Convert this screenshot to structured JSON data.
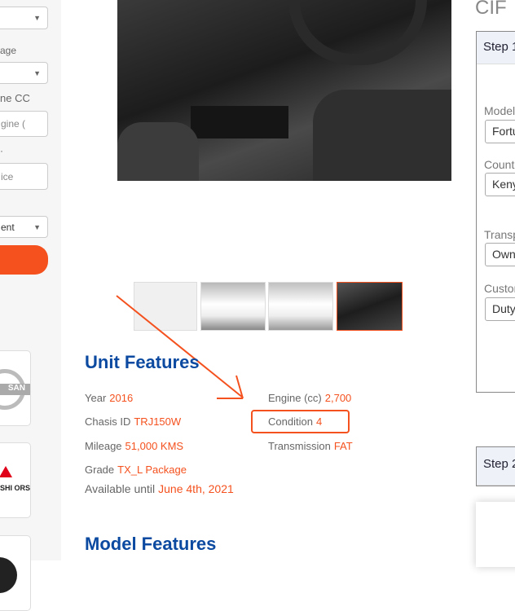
{
  "sidebar": {
    "labels": [
      "age",
      "ne CC",
      "·"
    ],
    "engine_placeholder": "gine (",
    "price_placeholder": "ice",
    "sort_value": "ent",
    "logos": [
      "nissan-logo",
      "mitsubishi-motors-logo",
      "brand-logo"
    ],
    "logo_text": {
      "nissan": "SAN",
      "mitsubishi": "BISHI ORS"
    }
  },
  "gallery": {
    "selected_index": 3,
    "thumb_count": 4
  },
  "unit_features": {
    "title": "Unit Features",
    "year": {
      "label": "Year",
      "value": "2016"
    },
    "chasis": {
      "label": "Chasis ID",
      "value": "TRJ150W"
    },
    "mileage": {
      "label": "Mileage",
      "value": "51,000 KMS"
    },
    "grade": {
      "label": "Grade",
      "value": "TX_L Package"
    },
    "available": {
      "label": "Available until",
      "value": "June 4th, 2021"
    },
    "engine": {
      "label": "Engine (cc)",
      "value": "2,700"
    },
    "condition": {
      "label": "Condition",
      "value": "4"
    },
    "transmission": {
      "label": "Transmission",
      "value": "FAT"
    }
  },
  "model_features": {
    "title": "Model Features"
  },
  "cif": {
    "title": "CIF",
    "step1": "Step 1",
    "step2": "Step 2",
    "fields": [
      {
        "label": "Model",
        "value": "Fortuner"
      },
      {
        "label": "Country",
        "value": "Kenya"
      },
      {
        "label": "Transport",
        "value": "Own"
      },
      {
        "label": "Customs",
        "value": "Duty"
      }
    ]
  },
  "colors": {
    "accent": "#f4511e",
    "heading": "#0b4aa0"
  }
}
